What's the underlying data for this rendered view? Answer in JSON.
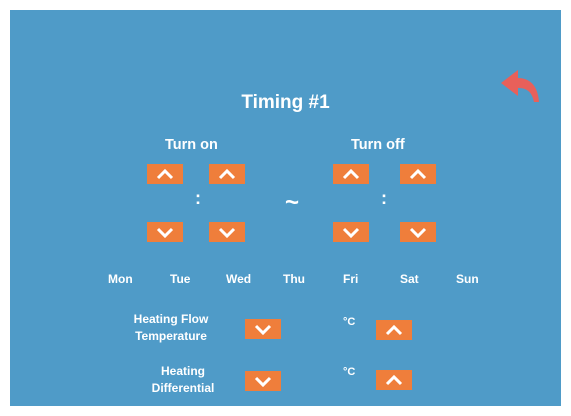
{
  "title": "Timing #1",
  "turn_on_label": "Turn on",
  "turn_off_label": "Turn off",
  "time_separator": ":",
  "range_separator": "~",
  "days": [
    "Mon",
    "Tue",
    "Wed",
    "Thu",
    "Fri",
    "Sat",
    "Sun"
  ],
  "heating_flow": {
    "label_line1": "Heating Flow",
    "label_line2": "Temperature",
    "unit": "°C"
  },
  "heating_differential": {
    "label_line1": "Heating",
    "label_line2": "Differential",
    "unit": "°C"
  },
  "colors": {
    "background": "#4f9bc8",
    "button": "#ef7e3b",
    "back_arrow": "#e8605a",
    "text": "#ffffff"
  },
  "icons": {
    "back": "undo-arrow-icon",
    "up": "chevron-up-icon",
    "down": "chevron-down-icon"
  }
}
